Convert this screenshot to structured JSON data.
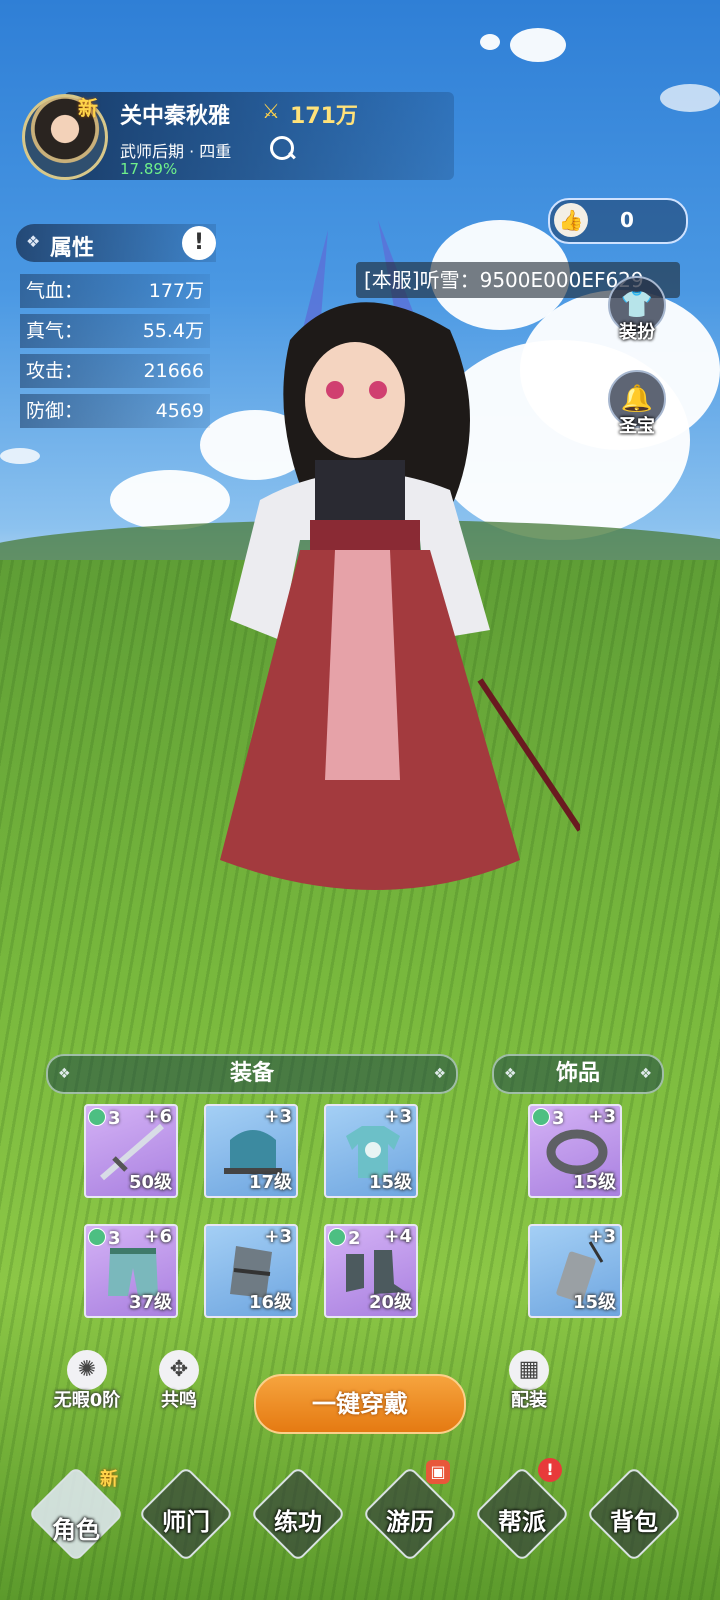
{
  "player": {
    "new_badge": "新",
    "name": "关中秦秋雅",
    "power": "171万",
    "realm": "武师后期 · 四重",
    "exp_percent": "17.89%"
  },
  "likes": {
    "count": "0"
  },
  "server_tag": "[本服]听雪：9500E000EF629",
  "side_buttons": [
    {
      "label": "装扮",
      "icon": "outfit-icon"
    },
    {
      "label": "圣宝",
      "icon": "bell-icon"
    }
  ],
  "attributes": {
    "title": "属性",
    "rows": [
      {
        "key": "气血：",
        "value": "177万"
      },
      {
        "key": "真气：",
        "value": "55.4万"
      },
      {
        "key": "攻击：",
        "value": "21666"
      },
      {
        "key": "防御：",
        "value": "4569"
      }
    ]
  },
  "equipment": {
    "title": "装备",
    "slots": [
      {
        "gem": "3",
        "plus": "+6",
        "level": "50级",
        "item": "sword",
        "rarity": "purple"
      },
      {
        "gem": "",
        "plus": "+3",
        "level": "17级",
        "item": "helmet",
        "rarity": "blue"
      },
      {
        "gem": "",
        "plus": "+3",
        "level": "15级",
        "item": "robe",
        "rarity": "blue"
      },
      {
        "gem": "3",
        "plus": "+6",
        "level": "37级",
        "item": "pants",
        "rarity": "purple"
      },
      {
        "gem": "",
        "plus": "+3",
        "level": "16级",
        "item": "bracer",
        "rarity": "blue"
      },
      {
        "gem": "2",
        "plus": "+4",
        "level": "20级",
        "item": "boots",
        "rarity": "purple"
      }
    ]
  },
  "accessories": {
    "title": "饰品",
    "slots": [
      {
        "gem": "3",
        "plus": "+3",
        "level": "15级",
        "item": "ring",
        "rarity": "purple"
      },
      {
        "gem": "",
        "plus": "+3",
        "level": "15级",
        "item": "pendant",
        "rarity": "blue"
      }
    ]
  },
  "actions": {
    "flawless": "无暇0阶",
    "resonance": "共鸣",
    "equip_all": "一键穿戴",
    "loadout": "配装"
  },
  "nav": [
    {
      "label": "角色",
      "badge": "新"
    },
    {
      "label": "师门",
      "badge": ""
    },
    {
      "label": "练功",
      "badge": ""
    },
    {
      "label": "游历",
      "badge": "chest"
    },
    {
      "label": "帮派",
      "badge": "!"
    },
    {
      "label": "背包",
      "badge": ""
    }
  ]
}
